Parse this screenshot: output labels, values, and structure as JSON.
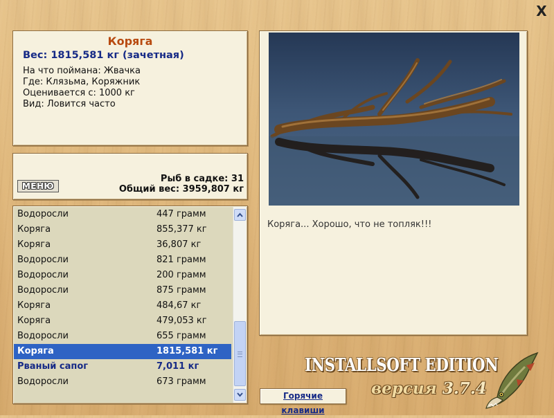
{
  "window": {
    "close_label": "X"
  },
  "catch_info": {
    "name": "Коряга",
    "weight": "Вес: 1815,581 кг (зачетная)",
    "caught_on": "На что поймана: Жвачка",
    "location": "Где: Клязьма, Коряжник",
    "valued_from": "Оценивается с: 1000 кг",
    "kind": "Вид: Ловится часто"
  },
  "keepnet": {
    "menu_label": "МЕНЮ",
    "fish_count": "Рыб в садке: 31",
    "total_weight": "Общий вес: 3959,807 кг"
  },
  "catch_list": {
    "rows": [
      {
        "name": "Водоросли",
        "weight": "447 грамм"
      },
      {
        "name": "Коряга",
        "weight": "855,377 кг"
      },
      {
        "name": "Коряга",
        "weight": "36,807 кг"
      },
      {
        "name": "Водоросли",
        "weight": "821 грамм"
      },
      {
        "name": "Водоросли",
        "weight": "200 грамм"
      },
      {
        "name": "Водоросли",
        "weight": "875 грамм"
      },
      {
        "name": "Коряга",
        "weight": "484,67 кг"
      },
      {
        "name": "Коряга",
        "weight": "479,053 кг"
      },
      {
        "name": "Водоросли",
        "weight": "655 грамм"
      },
      {
        "name": "Коряга",
        "weight": "1815,581 кг",
        "selected": true
      },
      {
        "name": "Рваный сапог",
        "weight": "7,011 кг",
        "trophy": true
      },
      {
        "name": "Водоросли",
        "weight": "673 грамм"
      }
    ]
  },
  "picture": {
    "caption": "Коряга... Хорошо, что не топляк!!!"
  },
  "hotkeys_label": "Горячие клавиши",
  "branding": {
    "edition": "INSTALLSOFT EDITION",
    "version_word": "версия",
    "version_number": "3.7.4"
  },
  "colors": {
    "title": "#b84a10",
    "weight": "#162a86",
    "selection": "#2e63c4",
    "panel": "#f6f1de"
  },
  "icons": [
    "close-icon",
    "scroll-up-icon",
    "scroll-down-icon",
    "pike-fish-icon"
  ]
}
